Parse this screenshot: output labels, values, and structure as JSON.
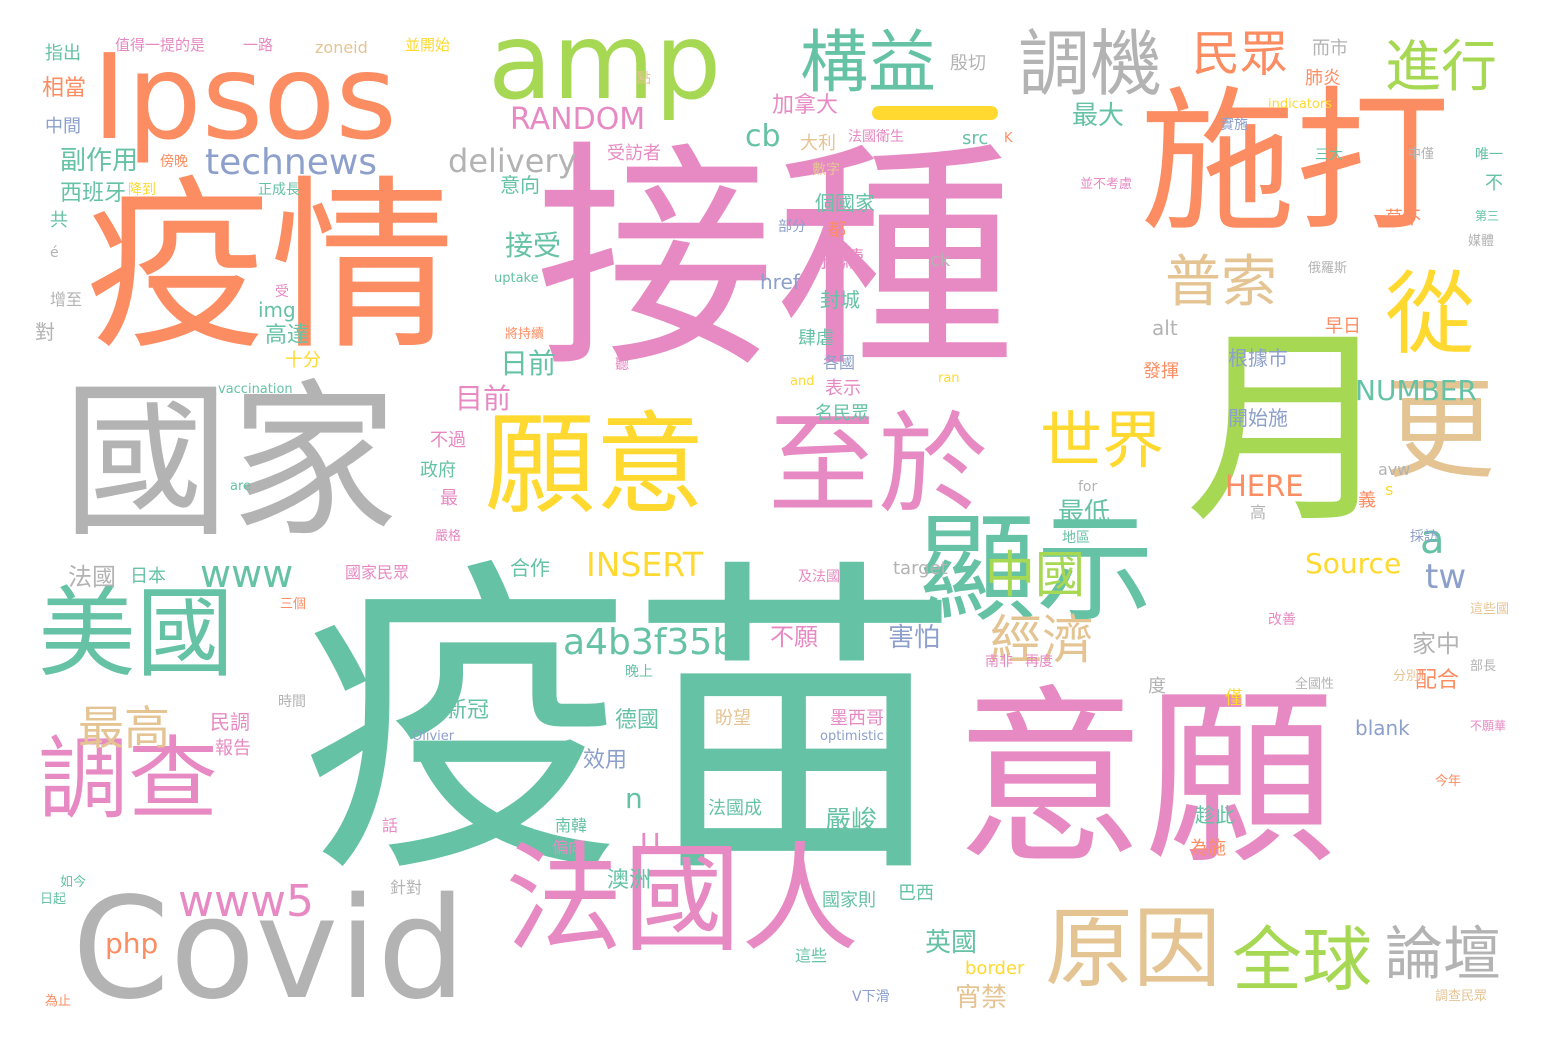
{
  "palette": {
    "green": "#66c2a5",
    "orange": "#fc8d62",
    "blue": "#8da0cb",
    "pink": "#e78ac3",
    "lime": "#a6d854",
    "yellow": "#ffd92f",
    "tan": "#e5c494",
    "gray": "#b3b3b3"
  },
  "words": [
    {
      "text": "疫苗",
      "color": "green"
    },
    {
      "text": "接種",
      "color": "pink"
    },
    {
      "text": "疫情",
      "color": "orange"
    },
    {
      "text": "國家",
      "color": "gray"
    },
    {
      "text": "意願",
      "color": "pink"
    },
    {
      "text": "施打",
      "color": "orange"
    },
    {
      "text": "月",
      "color": "lime"
    },
    {
      "text": "Ipsos",
      "color": "orange"
    },
    {
      "text": "amp",
      "color": "lime"
    },
    {
      "text": "Covid",
      "color": "gray"
    },
    {
      "text": "法國人",
      "color": "pink"
    },
    {
      "text": "願意",
      "color": "yellow"
    },
    {
      "text": "至於",
      "color": "pink"
    },
    {
      "text": "顯示",
      "color": "green"
    },
    {
      "text": "更",
      "color": "tan"
    },
    {
      "text": "從",
      "color": "yellow"
    },
    {
      "text": "美國",
      "color": "green"
    },
    {
      "text": "調查",
      "color": "pink"
    },
    {
      "text": "原因",
      "color": "tan"
    },
    {
      "text": "調機",
      "color": "gray"
    },
    {
      "text": "構益",
      "color": "green"
    },
    {
      "text": "世界",
      "color": "yellow"
    },
    {
      "text": "普索",
      "color": "tan"
    },
    {
      "text": "全球",
      "color": "lime"
    },
    {
      "text": "民眾",
      "color": "orange"
    },
    {
      "text": "進行",
      "color": "lime"
    },
    {
      "text": "technews",
      "color": "blue"
    },
    {
      "text": "delivery",
      "color": "gray"
    },
    {
      "text": "www",
      "color": "green"
    },
    {
      "text": "www5",
      "color": "pink"
    },
    {
      "text": "中國",
      "color": "lime"
    },
    {
      "text": "經濟",
      "color": "tan"
    },
    {
      "text": "最高",
      "color": "tan"
    },
    {
      "text": "論壇",
      "color": "gray"
    },
    {
      "text": "RANDOM",
      "color": "pink"
    },
    {
      "text": "INSERT",
      "color": "yellow"
    },
    {
      "text": "a4b3f35b",
      "color": "green"
    },
    {
      "text": "NUMBER",
      "color": "green"
    },
    {
      "text": "Source",
      "color": "yellow"
    },
    {
      "text": "HERE",
      "color": "orange"
    },
    {
      "text": "接受",
      "color": "green"
    },
    {
      "text": "日前",
      "color": "green"
    },
    {
      "text": "目前",
      "color": "pink"
    },
    {
      "text": "最大",
      "color": "green"
    },
    {
      "text": "加拿大",
      "color": "pink"
    },
    {
      "text": "php",
      "color": "orange"
    },
    {
      "text": "副作用",
      "color": "green"
    },
    {
      "text": "cb",
      "color": "green"
    },
    {
      "text": "tw",
      "color": "blue"
    },
    {
      "text": "a",
      "color": "green"
    },
    {
      "text": "不願",
      "color": "pink"
    },
    {
      "text": "害怕",
      "color": "blue"
    },
    {
      "text": "最低",
      "color": "green"
    },
    {
      "text": "合作",
      "color": "green"
    },
    {
      "text": "法國",
      "color": "gray"
    },
    {
      "text": "家中",
      "color": "gray"
    },
    {
      "text": "配合",
      "color": "orange"
    },
    {
      "text": "英國",
      "color": "green"
    },
    {
      "text": "宵禁",
      "color": "tan"
    },
    {
      "text": "嚴峻",
      "color": "green"
    },
    {
      "text": "新冠",
      "color": "green"
    },
    {
      "text": "德國",
      "color": "green"
    },
    {
      "text": "效用",
      "color": "blue"
    },
    {
      "text": "澳洲",
      "color": "green"
    },
    {
      "text": "持續",
      "color": "pink"
    },
    {
      "text": "封城",
      "color": "green"
    },
    {
      "text": "民調",
      "color": "pink"
    },
    {
      "text": "報告",
      "color": "pink"
    },
    {
      "text": "高達",
      "color": "green"
    },
    {
      "text": "十分",
      "color": "yellow"
    },
    {
      "text": "img",
      "color": "green"
    },
    {
      "text": "意向",
      "color": "green"
    },
    {
      "text": "受訪者",
      "color": "pink"
    },
    {
      "text": "西班牙",
      "color": "green"
    },
    {
      "text": "中間",
      "color": "blue"
    },
    {
      "text": "相當",
      "color": "orange"
    },
    {
      "text": "指出",
      "color": "green"
    },
    {
      "text": "值得一提的是",
      "color": "pink"
    },
    {
      "text": "一路",
      "color": "pink"
    },
    {
      "text": "zoneid",
      "color": "tan"
    },
    {
      "text": "並開始",
      "color": "yellow"
    },
    {
      "text": "殷切",
      "color": "gray"
    },
    {
      "text": "而市",
      "color": "gray"
    },
    {
      "text": "肺炎",
      "color": "orange"
    },
    {
      "text": "根據市",
      "color": "blue"
    },
    {
      "text": "開始施",
      "color": "blue"
    },
    {
      "text": "n",
      "color": "green"
    },
    {
      "text": "U",
      "color": "pink"
    },
    {
      "text": "盼望",
      "color": "tan"
    },
    {
      "text": "墨西哥",
      "color": "pink"
    },
    {
      "text": "法國成",
      "color": "green"
    },
    {
      "text": "國家民眾",
      "color": "pink"
    },
    {
      "text": "國家則",
      "color": "green"
    },
    {
      "text": "這些",
      "color": "green"
    },
    {
      "text": "巴西",
      "color": "green"
    },
    {
      "text": "blank",
      "color": "blue"
    },
    {
      "text": "border",
      "color": "yellow"
    },
    {
      "text": "href",
      "color": "blue"
    },
    {
      "text": "ck",
      "color": "gray"
    },
    {
      "text": "alt",
      "color": "gray"
    },
    {
      "text": "target",
      "color": "gray"
    },
    {
      "text": "政府",
      "color": "green"
    },
    {
      "text": "不過",
      "color": "pink"
    },
    {
      "text": "日本",
      "color": "green"
    },
    {
      "text": "名民眾",
      "color": "green"
    },
    {
      "text": "表示",
      "color": "pink"
    },
    {
      "text": "各國",
      "color": "blue"
    },
    {
      "text": "個國家",
      "color": "green"
    },
    {
      "text": "大利",
      "color": "tan"
    },
    {
      "text": "早日",
      "color": "orange"
    },
    {
      "text": "發揮",
      "color": "orange"
    },
    {
      "text": "src",
      "color": "green"
    },
    {
      "text": "南韓",
      "color": "green"
    },
    {
      "text": "偏向",
      "color": "pink"
    },
    {
      "text": "話",
      "color": "pink"
    },
    {
      "text": "對",
      "color": "gray"
    },
    {
      "text": "增至",
      "color": "gray"
    },
    {
      "text": "共",
      "color": "green"
    },
    {
      "text": "正成長",
      "color": "green"
    },
    {
      "text": "降到",
      "color": "yellow"
    },
    {
      "text": "部長",
      "color": "gray"
    },
    {
      "text": "全國性",
      "color": "gray"
    },
    {
      "text": "分別",
      "color": "tan"
    },
    {
      "text": "今年",
      "color": "orange"
    },
    {
      "text": "趁此",
      "color": "green"
    },
    {
      "text": "為施",
      "color": "orange"
    },
    {
      "text": "僅",
      "color": "yellow"
    },
    {
      "text": "度",
      "color": "gray"
    },
    {
      "text": "最",
      "color": "pink"
    },
    {
      "text": "義",
      "color": "orange"
    },
    {
      "text": "高",
      "color": "gray"
    },
    {
      "text": "不",
      "color": "green"
    },
    {
      "text": "三大",
      "color": "green"
    },
    {
      "text": "唯一",
      "color": "green"
    },
    {
      "text": "莫不",
      "color": "orange"
    },
    {
      "text": "都",
      "color": "orange"
    },
    {
      "text": "部分",
      "color": "blue"
    },
    {
      "text": "數字",
      "color": "tan"
    },
    {
      "text": "點",
      "color": "tan"
    },
    {
      "text": "聽",
      "color": "pink"
    },
    {
      "text": "中僅",
      "color": "gray"
    },
    {
      "text": "媒體",
      "color": "gray"
    },
    {
      "text": "俄羅斯",
      "color": "gray"
    },
    {
      "text": "地區",
      "color": "green"
    },
    {
      "text": "及法國",
      "color": "pink"
    },
    {
      "text": "改善",
      "color": "pink"
    },
    {
      "text": "這些國",
      "color": "tan"
    },
    {
      "text": "採訪",
      "color": "blue"
    },
    {
      "text": "南非",
      "color": "pink"
    },
    {
      "text": "再度",
      "color": "pink"
    },
    {
      "text": "針對",
      "color": "gray"
    },
    {
      "text": "如今",
      "color": "green"
    },
    {
      "text": "日起",
      "color": "green"
    },
    {
      "text": "為止",
      "color": "orange"
    },
    {
      "text": "時間",
      "color": "gray"
    },
    {
      "text": "三個",
      "color": "orange"
    },
    {
      "text": "晚上",
      "color": "green"
    },
    {
      "text": "Olivier",
      "color": "blue"
    },
    {
      "text": "optimistic",
      "color": "blue"
    },
    {
      "text": "vaccination",
      "color": "green"
    },
    {
      "text": "uptake",
      "color": "green"
    },
    {
      "text": "indicators",
      "color": "yellow"
    },
    {
      "text": "V下滑",
      "color": "blue"
    },
    {
      "text": "調查民眾",
      "color": "tan"
    },
    {
      "text": "avw",
      "color": "gray"
    },
    {
      "text": "for",
      "color": "gray"
    },
    {
      "text": "and",
      "color": "yellow"
    },
    {
      "text": "ran",
      "color": "yellow"
    },
    {
      "text": "are",
      "color": "green"
    },
    {
      "text": "嚴格",
      "color": "pink"
    },
    {
      "text": "將持續",
      "color": "orange"
    },
    {
      "text": "並不考慮",
      "color": "pink"
    },
    {
      "text": "法國衛生",
      "color": "pink"
    },
    {
      "text": "第三",
      "color": "green"
    },
    {
      "text": "不願華",
      "color": "pink"
    },
    {
      "text": "傍晚",
      "color": "orange"
    },
    {
      "text": "實施",
      "color": "blue"
    },
    {
      "text": "肆虐",
      "color": "green"
    },
    {
      "text": "受",
      "color": "pink"
    },
    {
      "text": "s",
      "color": "yellow"
    },
    {
      "text": "K",
      "color": "orange"
    },
    {
      "text": "é",
      "color": "gray"
    }
  ]
}
